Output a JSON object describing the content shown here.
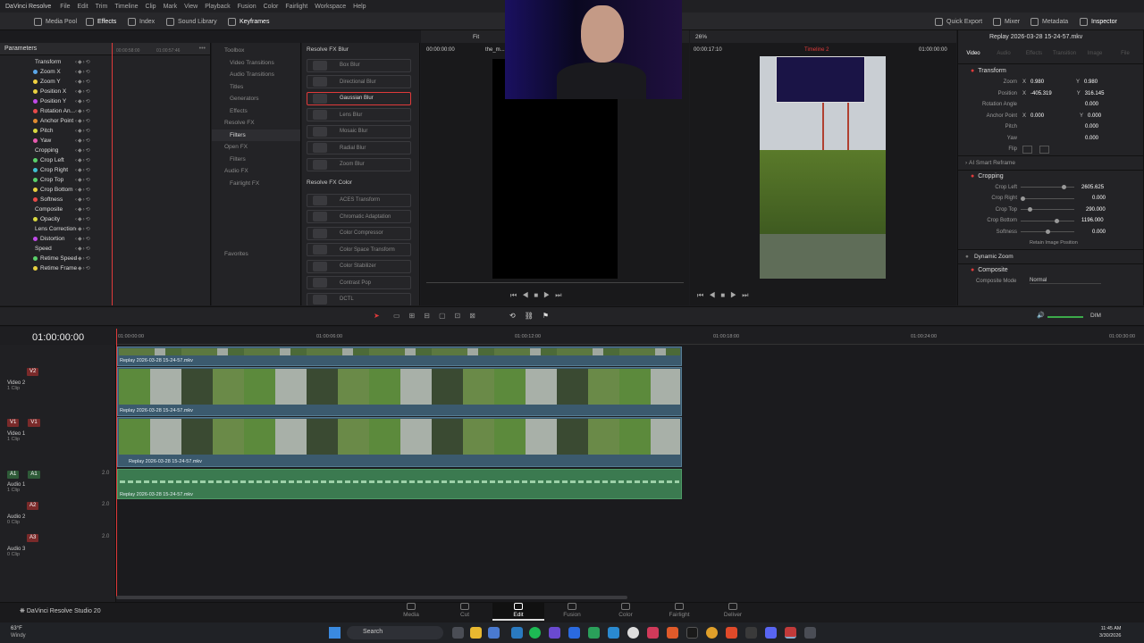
{
  "menubar": {
    "app": "DaVinci Resolve",
    "items": [
      "File",
      "Edit",
      "Trim",
      "Timeline",
      "Clip",
      "Mark",
      "View",
      "Playback",
      "Fusion",
      "Color",
      "Fairlight",
      "Workspace",
      "Help"
    ]
  },
  "toolbar": {
    "left": [
      "Media Pool",
      "Effects",
      "Index",
      "Sound Library",
      "Keyframes"
    ],
    "right": [
      "Quick Export",
      "Mixer",
      "Metadata",
      "Inspector"
    ]
  },
  "params": {
    "title": "Parameters",
    "items": [
      {
        "label": "Transform",
        "type": "group"
      },
      {
        "label": "Zoom X",
        "color": "#5aa7e8"
      },
      {
        "label": "Zoom Y",
        "color": "#f0d040"
      },
      {
        "label": "Position X",
        "color": "#e8d040"
      },
      {
        "label": "Position Y",
        "color": "#c04ae8"
      },
      {
        "label": "Rotation An...",
        "color": "#e84a4a"
      },
      {
        "label": "Anchor Point",
        "color": "#e08a30"
      },
      {
        "label": "Pitch",
        "color": "#d9d940"
      },
      {
        "label": "Yaw",
        "color": "#e85ab0"
      },
      {
        "label": "Cropping",
        "type": "group"
      },
      {
        "label": "Crop Left",
        "color": "#5ad06a"
      },
      {
        "label": "Crop Right",
        "color": "#40c0d0"
      },
      {
        "label": "Crop Top",
        "color": "#5ad06a"
      },
      {
        "label": "Crop Bottom",
        "color": "#e8d040"
      },
      {
        "label": "Softness",
        "color": "#e84a4a"
      },
      {
        "label": "Composite",
        "type": "group"
      },
      {
        "label": "Opacity",
        "color": "#d9d940"
      },
      {
        "label": "Lens Correction",
        "type": "group"
      },
      {
        "label": "Distortion",
        "color": "#c04ae8"
      },
      {
        "label": "Speed",
        "type": "group"
      },
      {
        "label": "Retime Speed",
        "color": "#5ad06a"
      },
      {
        "label": "Retime Frame",
        "color": "#e8d040"
      }
    ],
    "ruler": [
      "00:00:58:00",
      "01:00:57:46"
    ]
  },
  "toolbox": {
    "items": [
      {
        "label": "Toolbox",
        "level": 0
      },
      {
        "label": "Video Transitions",
        "level": 1
      },
      {
        "label": "Audio Transitions",
        "level": 1
      },
      {
        "label": "Titles",
        "level": 1
      },
      {
        "label": "Generators",
        "level": 1
      },
      {
        "label": "Effects",
        "level": 1
      },
      {
        "label": "Resolve FX",
        "level": 0
      },
      {
        "label": "Filters",
        "level": 1,
        "selected": true
      },
      {
        "label": "Open FX",
        "level": 0
      },
      {
        "label": "Filters",
        "level": 1
      },
      {
        "label": "Audio FX",
        "level": 0
      },
      {
        "label": "Fairlight FX",
        "level": 1
      }
    ],
    "favorites": "Favorites"
  },
  "fxlist": {
    "blur_header": "Resolve FX Blur",
    "blur": [
      "Box Blur",
      "Directional Blur",
      "Gaussian Blur",
      "Lens Blur",
      "Mosaic Blur",
      "Radial Blur",
      "Zoom Blur"
    ],
    "color_header": "Resolve FX Color",
    "color": [
      "ACES Transform",
      "Chromatic Adaptation",
      "Color Compressor",
      "Color Space Transform",
      "Color Stabilizer",
      "Contrast Pop",
      "DCTL"
    ]
  },
  "source_viewer": {
    "timecode_left": "00:00:00:00",
    "clip_name": "the_m...",
    "zoom": "Fit"
  },
  "timeline_viewer": {
    "zoom": "26%",
    "duration": "00:00:17:10",
    "timeline_name": "Timeline 2",
    "timecode": "01:00:00:00"
  },
  "inspector": {
    "clip_title": "Replay 2026-03-28 15-24-57.mkv",
    "tabs": [
      "Video",
      "Audio",
      "Effects",
      "Transition",
      "Image",
      "File"
    ],
    "transform_label": "Transform",
    "zoom": {
      "label": "Zoom",
      "x": "0.980",
      "y": "0.980"
    },
    "position": {
      "label": "Position",
      "x": "-405.319",
      "y": "316.145"
    },
    "rotation": {
      "label": "Rotation Angle",
      "value": "0.000"
    },
    "anchor": {
      "label": "Anchor Point",
      "x": "0.000",
      "y": "0.000"
    },
    "pitch": {
      "label": "Pitch",
      "value": "0.000"
    },
    "yaw": {
      "label": "Yaw",
      "value": "0.000"
    },
    "flip": {
      "label": "Flip"
    },
    "smart_reframe": "AI Smart Reframe",
    "cropping_label": "Cropping",
    "crop_left": {
      "label": "Crop Left",
      "value": "2605.625",
      "fraction": 0.82
    },
    "crop_right": {
      "label": "Crop Right",
      "value": "0.000",
      "fraction": 0.0
    },
    "crop_top": {
      "label": "Crop Top",
      "value": "290.000",
      "fraction": 0.15
    },
    "crop_bottom": {
      "label": "Crop Bottom",
      "value": "1196.000",
      "fraction": 0.68
    },
    "softness": {
      "label": "Softness",
      "value": "0.000",
      "fraction": 0.5
    },
    "retain": "Retain Image Position",
    "dynamic_zoom": "Dynamic Zoom",
    "composite_label": "Composite",
    "composite_mode_label": "Composite Mode",
    "composite_mode": "Normal"
  },
  "timeline": {
    "timecode": "01:00:00:00",
    "ruler": [
      "01:00:00:00",
      "01:00:06:00",
      "01:00:12:00",
      "01:00:18:00",
      "01:00:24:00",
      "01:00:30:00"
    ],
    "tracks": {
      "v2": {
        "badge": "V2",
        "name": "Video 2",
        "count": "1 Clip"
      },
      "v1": {
        "badge": "V1",
        "name": "Video 1",
        "count": "1 Clip"
      },
      "a1": {
        "badge": "A1",
        "name": "Audio 1",
        "count": "1 Clip",
        "level": "2.0"
      },
      "a2": {
        "badge": "A2",
        "name": "Audio 2",
        "count": "0 Clip",
        "level": "2.0"
      },
      "a3": {
        "badge": "A3",
        "name": "Audio 3",
        "count": "0 Clip",
        "level": "2.0"
      }
    },
    "clip_name": "Replay 2026-03-28 15-24-57.mkv",
    "audio_level_label": "DIM"
  },
  "pages": {
    "brand": "DaVinci Resolve Studio 20",
    "tabs": [
      "Media",
      "Cut",
      "Edit",
      "Fusion",
      "Color",
      "Fairlight",
      "Deliver"
    ],
    "active": "Edit"
  },
  "taskbar": {
    "weather_temp": "63°F",
    "weather_desc": "Windy",
    "search": "Search",
    "time": "11:45 AM",
    "date": "3/30/2026"
  }
}
